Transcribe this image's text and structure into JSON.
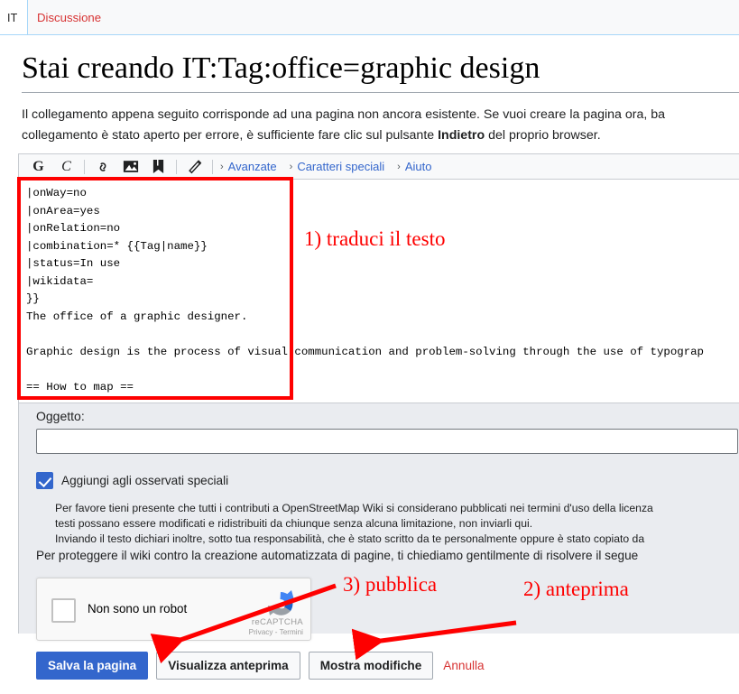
{
  "tabs": {
    "namespace_label": "IT",
    "talk_label": "Discussione"
  },
  "page_title": "Stai creando IT:Tag:office=graphic design",
  "intro": {
    "line1": "Il collegamento appena seguito corrisponde ad una pagina non ancora esistente. Se vuoi creare la pagina ora, ba",
    "line2_pre": "collegamento è stato aperto per errore, è sufficiente fare clic sul pulsante ",
    "line2_bold": "Indietro",
    "line2_post": " del proprio browser."
  },
  "toolbar": {
    "bold_glyph": "G",
    "italic_glyph": "C",
    "link_icon": "link-icon",
    "image_icon": "image-icon",
    "reference_icon": "reference-icon",
    "signature_icon": "signature-icon",
    "chevron": "›",
    "advanced_label": "Avanzate",
    "special_chars_label": "Caratteri speciali",
    "help_label": "Aiuto"
  },
  "editor": {
    "wikitext": "|onWay=no\n|onArea=yes\n|onRelation=no\n|combination=* {{Tag|name}}\n|status=In use\n|wikidata=\n}}\nThe office of a graphic designer.\n\nGraphic design is the process of visual communication and problem-solving through the use of typograp\n\n== How to map =="
  },
  "form": {
    "summary_label": "Oggetto:",
    "summary_value": "",
    "summary_placeholder": "",
    "watch_label": "Aggiungi agli osservati speciali",
    "watch_checked": true,
    "legal_line1": "Per favore tieni presente che tutti i contributi a OpenStreetMap Wiki si considerano pubblicati nei termini d'uso della licenza",
    "legal_line2": "testi possano essere modificati e ridistribuiti da chiunque senza alcuna limitazione, non inviarli qui.",
    "legal_line3": "Inviando il testo dichiari inoltre, sotto tua responsabilità, che è stato scritto da te personalmente oppure è stato copiato da",
    "captcha_prompt": "Per proteggere il wiki contro la creazione automatizzata di pagine, ti chiediamo gentilmente di risolvere il segue"
  },
  "recaptcha": {
    "checkbox_label": "Non sono un robot",
    "brand": "reCAPTCHA",
    "privacy_label": "Privacy",
    "separator": "-",
    "terms_label": "Termini"
  },
  "actions": {
    "save_label": "Salva la pagina",
    "preview_label": "Visualizza anteprima",
    "diff_label": "Mostra modifiche",
    "cancel_label": "Annulla"
  },
  "annotations": {
    "step1": "1) traduci il testo",
    "step2": "2) anteprima",
    "step3": "3) pubblica",
    "color": "#fe0000"
  }
}
